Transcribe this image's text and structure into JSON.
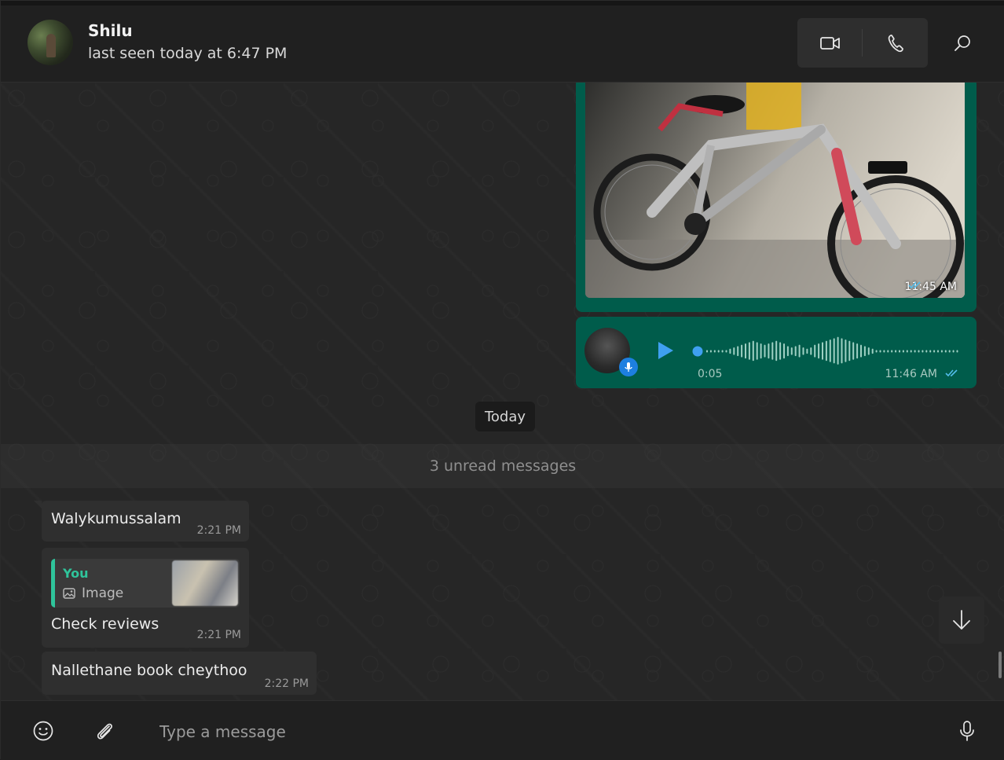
{
  "header": {
    "contact_name": "Shilu",
    "last_seen": "last seen today at 6:47 PM",
    "actions": [
      "video-call",
      "voice-call",
      "search"
    ]
  },
  "messages": {
    "outgoing_image": {
      "time": "11:45 AM",
      "status": "read"
    },
    "outgoing_voice": {
      "duration": "0:05",
      "time": "11:46 AM",
      "status": "read"
    },
    "date_chip": "Today",
    "unread_banner": "3 unread messages",
    "incoming": [
      {
        "text": "Walykumussalam",
        "time": "2:21 PM"
      },
      {
        "quote": {
          "author": "You",
          "type_label": "Image"
        },
        "text": "Check reviews",
        "time": "2:21 PM"
      },
      {
        "text": "Nallethane book cheythoo",
        "time": "2:22 PM"
      }
    ]
  },
  "composer": {
    "placeholder": "Type a message"
  },
  "colors": {
    "outgoing_bubble": "#005c4b",
    "incoming_bubble": "#2f2f2f",
    "accent_green": "#2fc49b",
    "read_ticks": "#53bdeb"
  }
}
